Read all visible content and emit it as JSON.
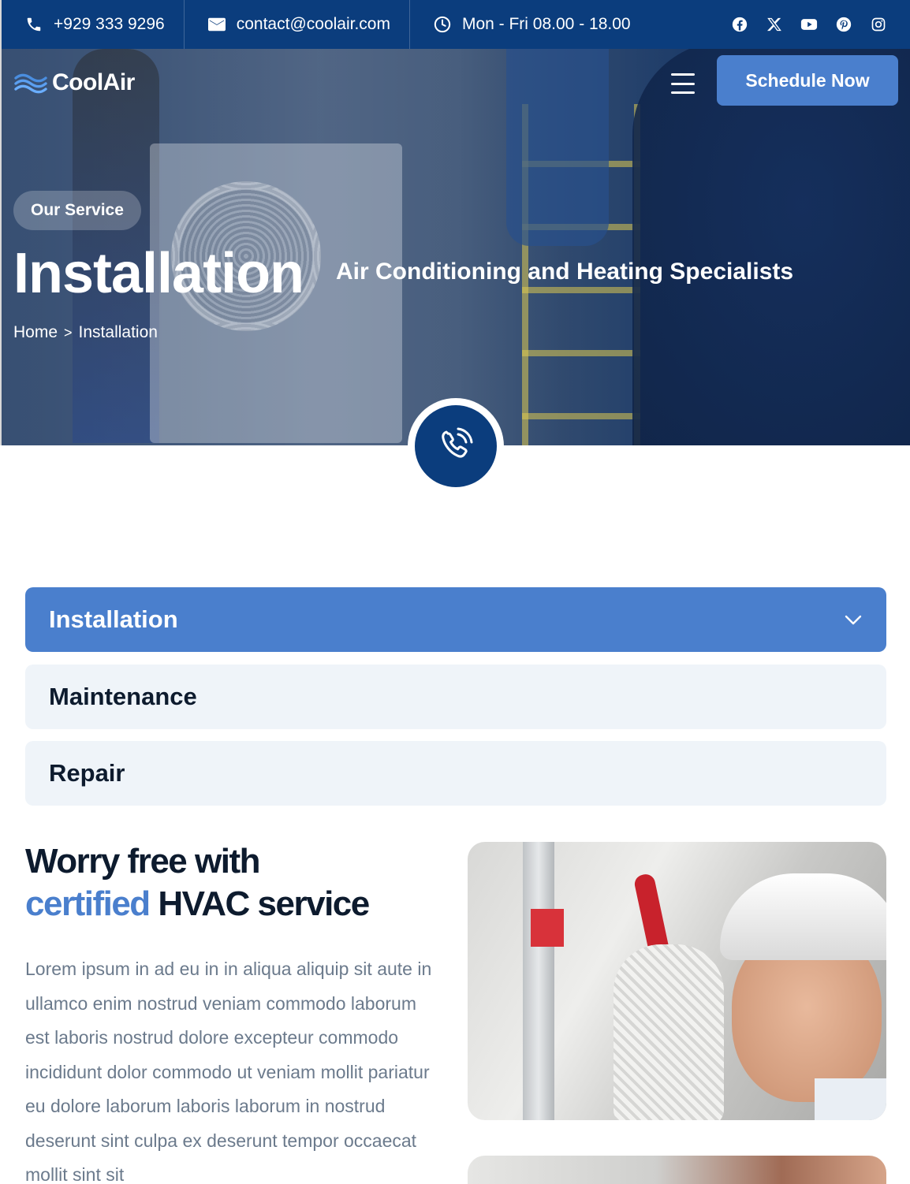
{
  "topbar": {
    "phone": "+929 333 9296",
    "email": "contact@coolair.com",
    "hours": "Mon - Fri 08.00 - 18.00",
    "social": [
      "facebook-icon",
      "x-icon",
      "youtube-icon",
      "pinterest-icon",
      "instagram-icon"
    ]
  },
  "header": {
    "logo_text": "CoolAir",
    "cta_label": "Schedule Now"
  },
  "hero": {
    "tag": "Our Service",
    "title": "Installation",
    "subtitle": "Air Conditioning and Heating Specialists",
    "breadcrumb": {
      "home": "Home",
      "separator": ">",
      "current": "Installation"
    }
  },
  "accordion": {
    "items": [
      {
        "label": "Installation",
        "state": "expanded"
      },
      {
        "label": "Maintenance",
        "state": "collapsed"
      },
      {
        "label": "Repair",
        "state": "collapsed"
      }
    ]
  },
  "content": {
    "title_line1": "Worry free with",
    "title_accent": "certified",
    "title_rest": " HVAC service",
    "body": "Lorem ipsum in ad eu in in aliqua aliquip sit aute in ullamco enim nostrud veniam commodo laborum est laboris nostrud dolore excepteur commodo incididunt dolor commodo ut veniam mollit pariatur eu dolore laborum laboris laborum in nostrud deserunt sint culpa ex deserunt tempor occaecat mollit sint sit"
  },
  "colors": {
    "primary_dark": "#0b3d7d",
    "accent": "#4a7fcd",
    "panel": "#eff4f9",
    "text_dark": "#0d1b2e",
    "text_muted": "#6b7a8c"
  }
}
